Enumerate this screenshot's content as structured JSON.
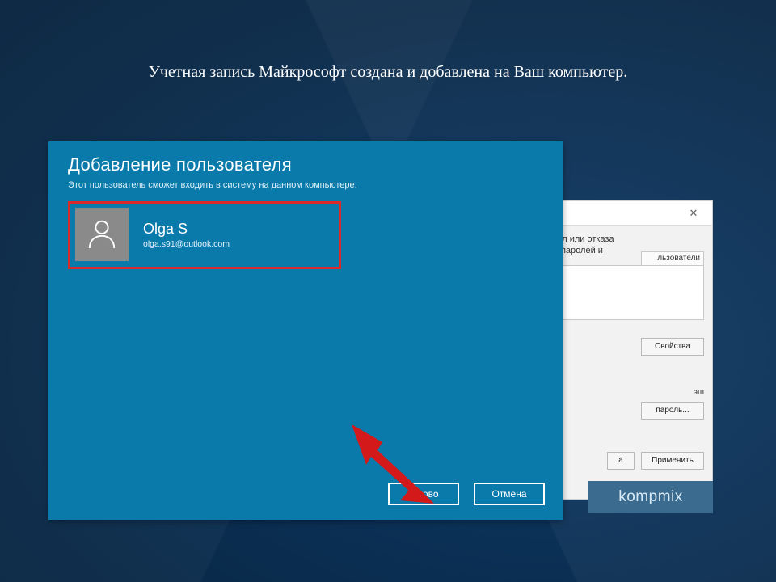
{
  "caption": "Учетная запись Майкрософт создана и добавлена на Ваш компьютер.",
  "dialog": {
    "title": "Добавление пользователя",
    "subtitle": "Этот пользователь сможет входить в систему на данном компьютере.",
    "user": {
      "name": "Olga S",
      "email": "olga.s91@outlook.com"
    },
    "buttons": {
      "done": "Готово",
      "cancel": "Отмена"
    }
  },
  "bg_dialog": {
    "hint1": "нил или отказа",
    "hint2": "ы паролей и",
    "tab_users": "льзователи",
    "btn_properties": "Свойства",
    "txt_vash": "эш",
    "btn_password": "пароль...",
    "btn_a": "а",
    "btn_apply": "Применить"
  },
  "watermark": "kompmix"
}
